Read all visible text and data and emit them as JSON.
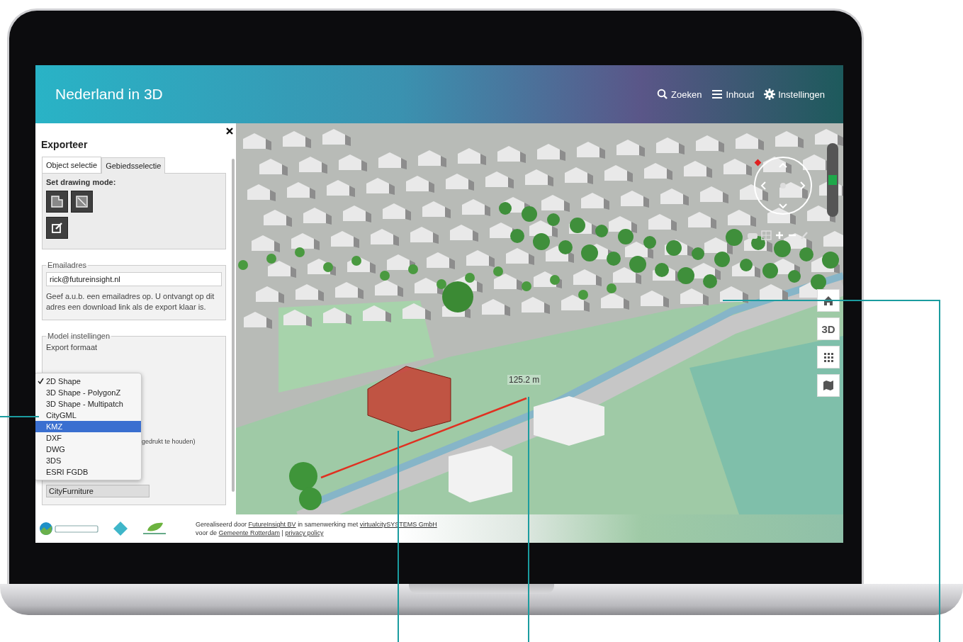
{
  "header": {
    "title": "Nederland in 3D",
    "nav": [
      {
        "kind": "search",
        "label": "Zoeken"
      },
      {
        "kind": "menu",
        "label": "Inhoud"
      },
      {
        "kind": "settings",
        "label": "Instellingen"
      }
    ]
  },
  "panel": {
    "title": "Exporteer",
    "tabs": [
      {
        "label": "Object selectie",
        "selected": false
      },
      {
        "label": "Gebiedsselectie",
        "selected": true
      }
    ],
    "drawing_mode": {
      "label": "Set drawing mode:",
      "tools": [
        {
          "kind": "polygon"
        },
        {
          "kind": "rectangle"
        },
        {
          "kind": "edit"
        }
      ]
    },
    "email": {
      "legend": "Emailadres",
      "value": "rick@futureinsight.nl",
      "help": "Geef a.u.b. een emailadres op. U ontvangt op dit adres een download link als de export klaar is."
    },
    "model": {
      "legend": "Model instellingen",
      "format_label": "Export formaat",
      "partial_text": "gedrukt te houden)",
      "field_value": "CityFurniture",
      "options": [
        {
          "label": "2D Shape",
          "checked": true,
          "selected": false
        },
        {
          "label": "3D Shape - PolygonZ",
          "checked": false,
          "selected": false
        },
        {
          "label": "3D Shape - Multipatch",
          "checked": false,
          "selected": false
        },
        {
          "label": "CityGML",
          "checked": false,
          "selected": false
        },
        {
          "label": "KMZ",
          "checked": false,
          "selected": true
        },
        {
          "label": "DXF",
          "checked": false,
          "selected": false
        },
        {
          "label": "DWG",
          "checked": false,
          "selected": false
        },
        {
          "label": "3DS",
          "checked": false,
          "selected": false
        },
        {
          "label": "ESRI FGDB",
          "checked": false,
          "selected": false
        }
      ]
    }
  },
  "map": {
    "measurement": "125.2 m",
    "zoom": {
      "level": 0.5
    },
    "buttons": [
      {
        "kind": "home"
      },
      {
        "kind": "view",
        "label": "3D"
      },
      {
        "kind": "grid"
      },
      {
        "kind": "map"
      }
    ]
  },
  "footer": {
    "lines": [
      [
        {
          "kind": "text",
          "text": "Gerealiseerd door"
        },
        {
          "kind": "link",
          "text": "FutureInsight BV"
        },
        {
          "kind": "text",
          "text": "in samenwerking met"
        },
        {
          "kind": "link",
          "text": "virtualcitySYSTEMS GmbH"
        }
      ],
      [
        {
          "kind": "text",
          "text": "voor de"
        },
        {
          "kind": "link",
          "text": "Gemeente Rotterdam"
        },
        {
          "kind": "text",
          "text": "|"
        },
        {
          "kind": "link",
          "text": "privacy policy"
        }
      ]
    ]
  }
}
